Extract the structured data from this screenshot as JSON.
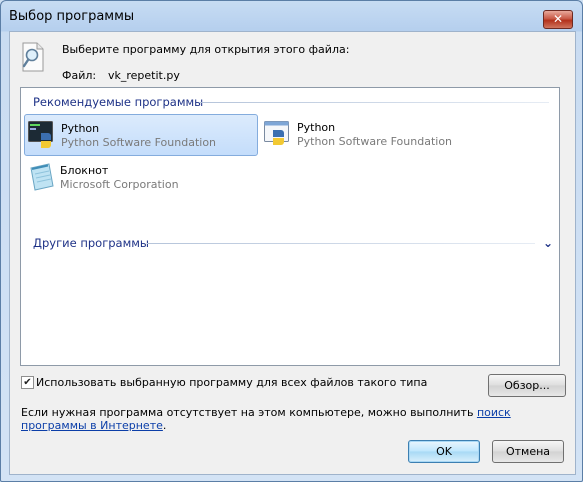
{
  "window": {
    "title": "Выбор программы",
    "close_glyph": "✕"
  },
  "header": {
    "prompt": "Выберите программу для открытия этого файла:",
    "file_label": "Файл:",
    "file_name": "vk_repetit.py",
    "icon": "magnifier-document-icon"
  },
  "recommended": {
    "header": "Рекомендуемые программы",
    "items": [
      {
        "name": "Python",
        "publisher": "Python Software Foundation",
        "icon": "python-console-icon",
        "selected": true
      },
      {
        "name": "Python",
        "publisher": "Python Software Foundation",
        "icon": "python-window-icon",
        "selected": false
      },
      {
        "name": "Блокнот",
        "publisher": "Microsoft Corporation",
        "icon": "notepad-icon",
        "selected": false
      }
    ]
  },
  "other": {
    "header": "Другие программы",
    "expand_glyph": "⌄"
  },
  "options": {
    "always_use_label": "Использовать выбранную программу для всех файлов такого типа",
    "always_use_checked": true,
    "check_glyph": "✔"
  },
  "browse_label": "Обзор...",
  "info": {
    "text": "Если нужная программа отсутствует на этом компьютере, можно выполнить ",
    "link_text": "поиск программы в Интернете",
    "text_end": "."
  },
  "buttons": {
    "ok": "OK",
    "cancel": "Отмена"
  },
  "colors": {
    "accent_header": "#1e3287",
    "link": "#0b3ea8",
    "selection": "#c4ddfb"
  }
}
